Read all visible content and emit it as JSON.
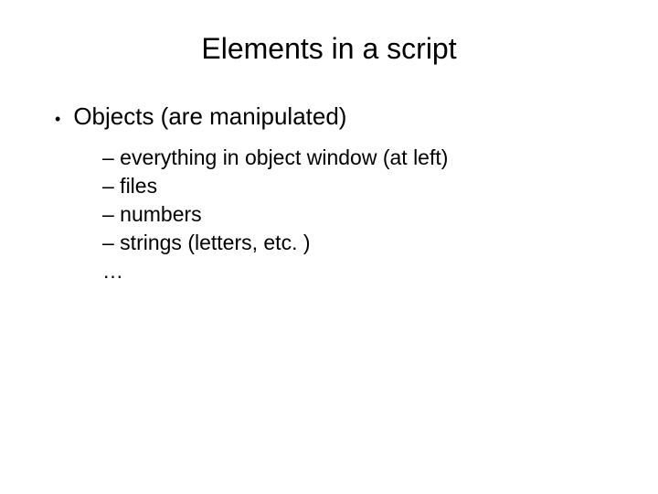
{
  "slide": {
    "title": "Elements in a script",
    "bullet1": {
      "marker": "•",
      "text": "Objects (are manipulated)"
    },
    "sub1": "– everything in object window (at left)",
    "sub2": "– files",
    "sub3": "– numbers",
    "sub4": "– strings (letters, etc. )",
    "sub5": "…"
  }
}
